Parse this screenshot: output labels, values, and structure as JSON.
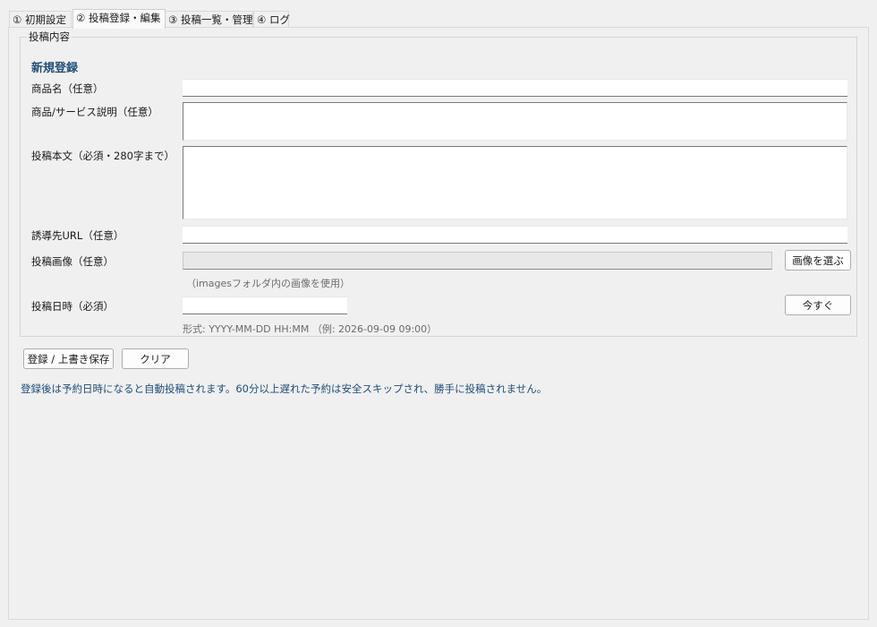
{
  "tabs": [
    {
      "label": "① 初期設定",
      "active": false
    },
    {
      "label": "② 投稿登録・編集",
      "active": true
    },
    {
      "label": "③ 投稿一覧・管理",
      "active": false
    },
    {
      "label": "④ ログ",
      "active": false
    }
  ],
  "form": {
    "group_title": "投稿内容",
    "heading": "新規登録",
    "product_name_label": "商品名（任意）",
    "product_name_value": "",
    "description_label": "商品/サービス説明（任意）",
    "description_value": "",
    "body_label": "投稿本文（必須・280字まで）",
    "body_value": "",
    "url_label": "誘導先URL（任意）",
    "url_value": "",
    "image_label": "投稿画像（任意）",
    "image_value": "",
    "image_button": "画像を選ぶ",
    "image_hint": "（imagesフォルダ内の画像を使用）",
    "datetime_label": "投稿日時（必須）",
    "datetime_value": "",
    "now_button": "今すぐ",
    "datetime_hint": "形式: YYYY-MM-DD HH:MM （例: 2026-09-09 09:00）"
  },
  "actions": {
    "save_button": "登録 / 上書き保存",
    "clear_button": "クリア"
  },
  "info_text": "登録後は予約日時になると自動投稿されます。60分以上遅れた予約は安全スキップされ、勝手に投稿されません。",
  "colors": {
    "accent": "#1f4e79",
    "background": "#f0f0f0"
  }
}
